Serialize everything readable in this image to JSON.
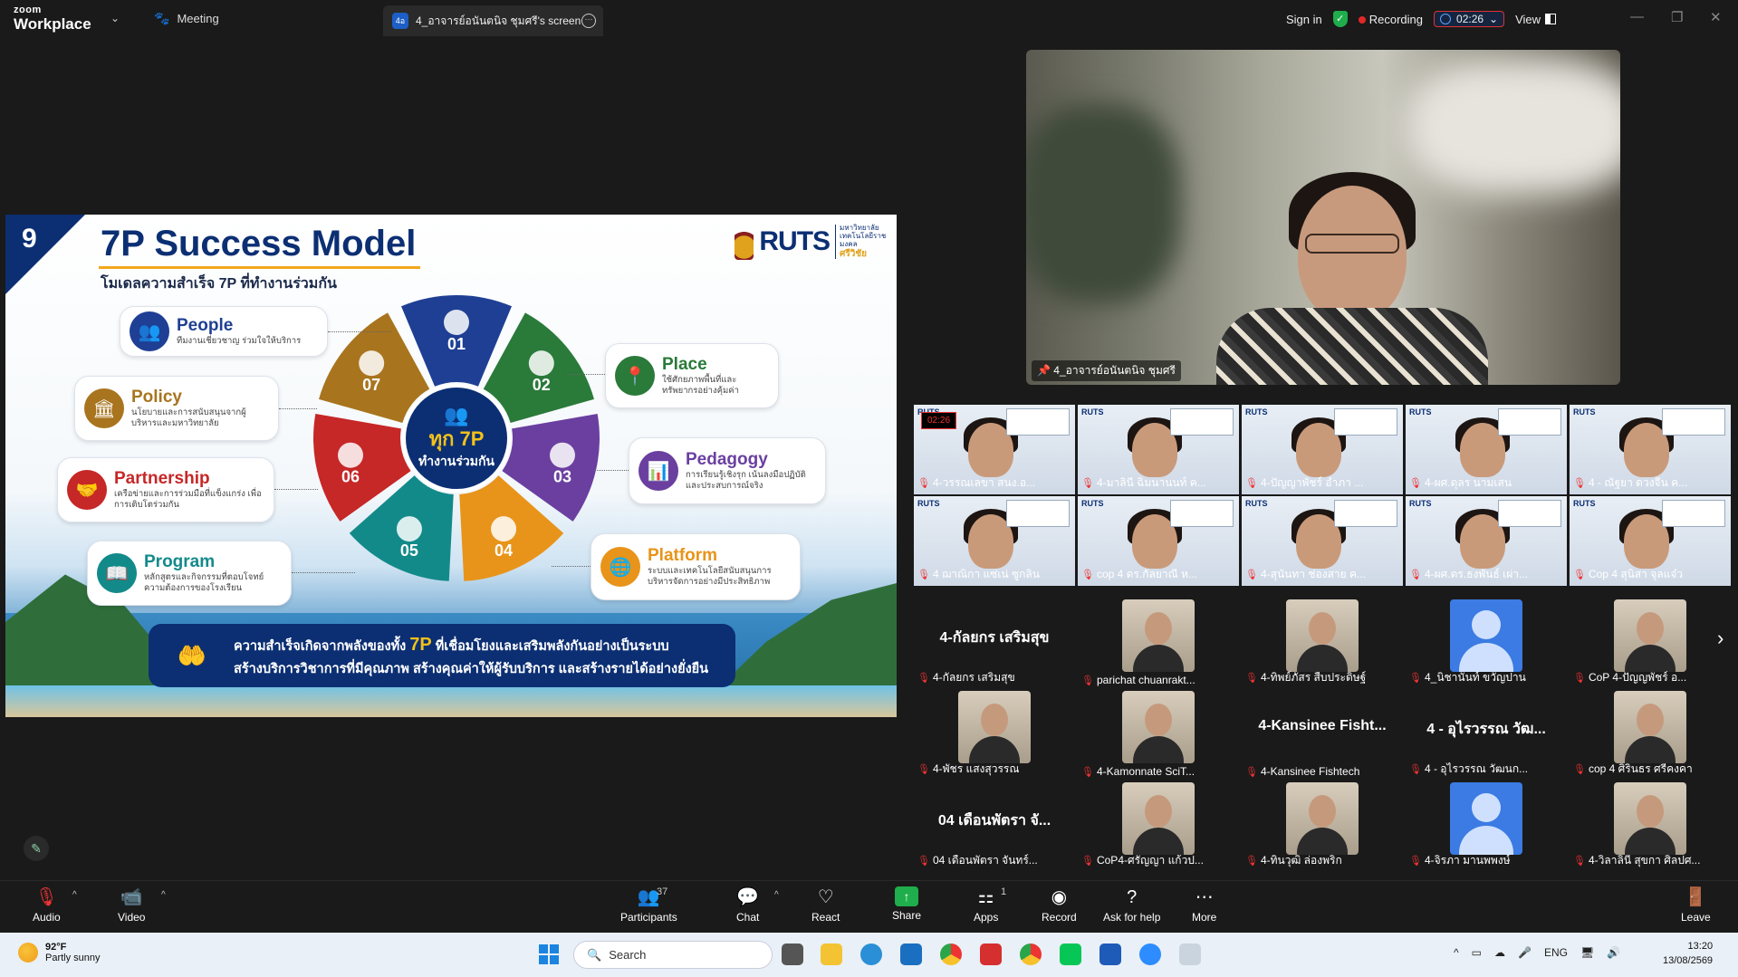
{
  "app": {
    "logo_top": "zoom",
    "logo_bottom": "Workplace"
  },
  "tabs": {
    "meeting": "Meeting",
    "share": "4_อาจารย์อนันตนิจ ชุมศรี's screen",
    "share_badge": "4อ"
  },
  "topbar": {
    "sign_in": "Sign in",
    "recording": "Recording",
    "timer": "02:26",
    "view": "View"
  },
  "slide": {
    "number": "9",
    "title": "7P Success Model",
    "subtitle": "โมเดลความสำเร็จ 7P ที่ทำงานร่วมกัน",
    "brand": "RUTS",
    "brand_side_top": "มหาวิทยาลัย",
    "brand_side_mid": "เทคโนโลยีราชมงคล",
    "brand_side_bottom": "ศรีวิชัย",
    "center_top": "ทุก 7P",
    "center_bottom": "ทำงานร่วมกัน",
    "segments": [
      "01",
      "02",
      "03",
      "04",
      "05",
      "06",
      "07"
    ],
    "cards": [
      {
        "title": "People",
        "desc": "ทีมงานเชี่ยวชาญ ร่วมใจให้บริการ",
        "color": "#1e3f94"
      },
      {
        "title": "Place",
        "desc": "ใช้ศักยภาพพื้นที่และทรัพยากรอย่างคุ้มค่า",
        "color": "#2a7a3a"
      },
      {
        "title": "Pedagogy",
        "desc": "การเรียนรู้เชิงรุก เน้นลงมือปฏิบัติและประสบการณ์จริง",
        "color": "#6a3fa0"
      },
      {
        "title": "Platform",
        "desc": "ระบบและเทคโนโลยีสนับสนุนการบริหารจัดการอย่างมีประสิทธิภาพ",
        "color": "#e8941a"
      },
      {
        "title": "Program",
        "desc": "หลักสูตรและกิจกรรมที่ตอบโจทย์ความต้องการของโรงเรียน",
        "color": "#138a8a"
      },
      {
        "title": "Partnership",
        "desc": "เครือข่ายและการร่วมมือที่แข็งแกร่ง เพื่อการเติบโตร่วมกัน",
        "color": "#c62727"
      },
      {
        "title": "Policy",
        "desc": "นโยบายและการสนับสนุนจากผู้บริหารและมหาวิทยาลัย",
        "color": "#a8741e"
      }
    ],
    "banner_line1_a": "ความสำเร็จเกิดจากพลังของทั้ง ",
    "banner_line1_b": "7P",
    "banner_line1_c": " ที่เชื่อมโยงและเสริมพลังกันอย่างเป็นระบบ",
    "banner_line2": "สร้างบริการวิชาการที่มีคุณภาพ สร้างคุณค่าให้ผู้รับบริการ และสร้างรายได้อย่างยั่งยืน"
  },
  "speaker": {
    "name": "4_อาจารย์อนันตนิจ ชุมศรี"
  },
  "participants_grid": {
    "row1": [
      "4-วรรณเลขา สนง.อ...",
      "4-มาลินี ฉิมนานนท์ ค...",
      "4-ปัญญาพัชร์ อำภา ...",
      "4-ผศ.ดุลร นามเสน",
      "4 - ณัฐยา ดวงจีน ค..."
    ],
    "row2": [
      "4 ฌาณิกา แซ่เน่ ซูกลิน",
      "cop 4 ดร.กัลยาณี ห...",
      "4-สุนันทา ช่องสาย ค...",
      "4-ผศ.ดร.ธงพันธ์ เผ่า...",
      "Cop 4 สุนิสา จุลแจ๋ว"
    ],
    "rec_badge": "02:26",
    "row3_big": "4-กัลยกร เสริมสุข",
    "row3": [
      "4-กัลยกร เสริมสุข",
      "parichat chuanrakt...",
      "4-ทิพย์ภัสร สืบประดิษฐ์",
      "4_นิชานันท์ ขวัญปาน",
      "CoP 4-ปัญญพัชร์ อ..."
    ],
    "row4_big_a": "4-Kansinee Fisht...",
    "row4_big_b": "4 - อุไรวรรณ วัฒ...",
    "row4": [
      "4-พัชร แสงสุวรรณ",
      "4-Kamonnate SciT...",
      "4-Kansinee Fishtech",
      "4 - อุไรวรรณ วัฒนก...",
      "cop 4 ศิรินธร ศรีคงคา"
    ],
    "row5_big": "04 เดือนพัตรา จั...",
    "row5": [
      "04 เดือนพัตรา จันทร์...",
      "CoP4-ศรัญญา แก้วป...",
      "4-ทินวุฒิ ล่องพริก",
      "4-จิรภา มานพพงษ์",
      "4-วิลาลินี สุขกา ศิลปศ..."
    ]
  },
  "toolbar": {
    "audio": "Audio",
    "video": "Video",
    "participants": "Participants",
    "participants_count": "37",
    "chat": "Chat",
    "react": "React",
    "share": "Share",
    "apps": "Apps",
    "apps_count": "1",
    "record": "Record",
    "ask_help": "Ask for help",
    "more": "More",
    "leave": "Leave"
  },
  "taskbar": {
    "temp": "92°F",
    "weather": "Partly sunny",
    "search": "Search",
    "lang": "ENG",
    "time": "13:20",
    "date": "13/08/2569"
  }
}
